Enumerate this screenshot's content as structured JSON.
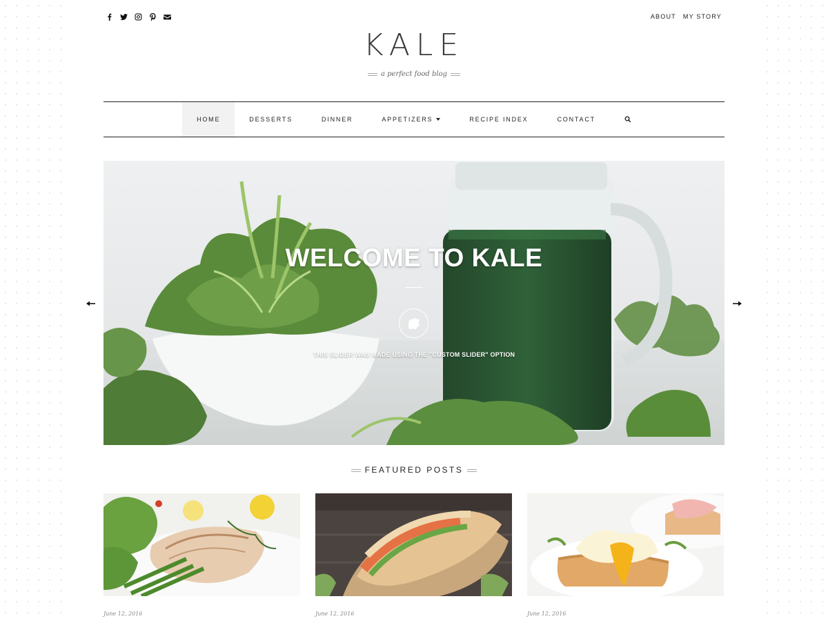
{
  "social": [
    {
      "icon": "facebook-icon"
    },
    {
      "icon": "twitter-icon"
    },
    {
      "icon": "instagram-icon"
    },
    {
      "icon": "pinterest-icon"
    },
    {
      "icon": "email-icon"
    }
  ],
  "top_links": {
    "about": "ABOUT",
    "my_story": "MY STORY"
  },
  "site": {
    "logo": "KALE",
    "tagline": "a perfect food blog"
  },
  "nav": {
    "home": "HOME",
    "desserts": "DESSERTS",
    "dinner": "DINNER",
    "appetizers": "APPETIZERS",
    "recipe_index": "RECIPE INDEX",
    "contact": "CONTACT",
    "search_icon": "search-icon"
  },
  "slider": {
    "title": "WELCOME TO KALE",
    "icon": "apple-icon",
    "subtitle": "THIS SLIDER WAS MADE USING THE \"CUSTOM SLIDER\" OPTION"
  },
  "featured": {
    "heading": "FEATURED POSTS",
    "posts": [
      {
        "date": "June 12, 2016"
      },
      {
        "date": "June 12, 2016"
      },
      {
        "date": "June 12, 2016"
      }
    ]
  },
  "colors": {
    "text": "#222222",
    "nav_active_bg": "#f2f2f2",
    "kale_green": "#4f7c36",
    "juice_green": "#2d5a35"
  }
}
